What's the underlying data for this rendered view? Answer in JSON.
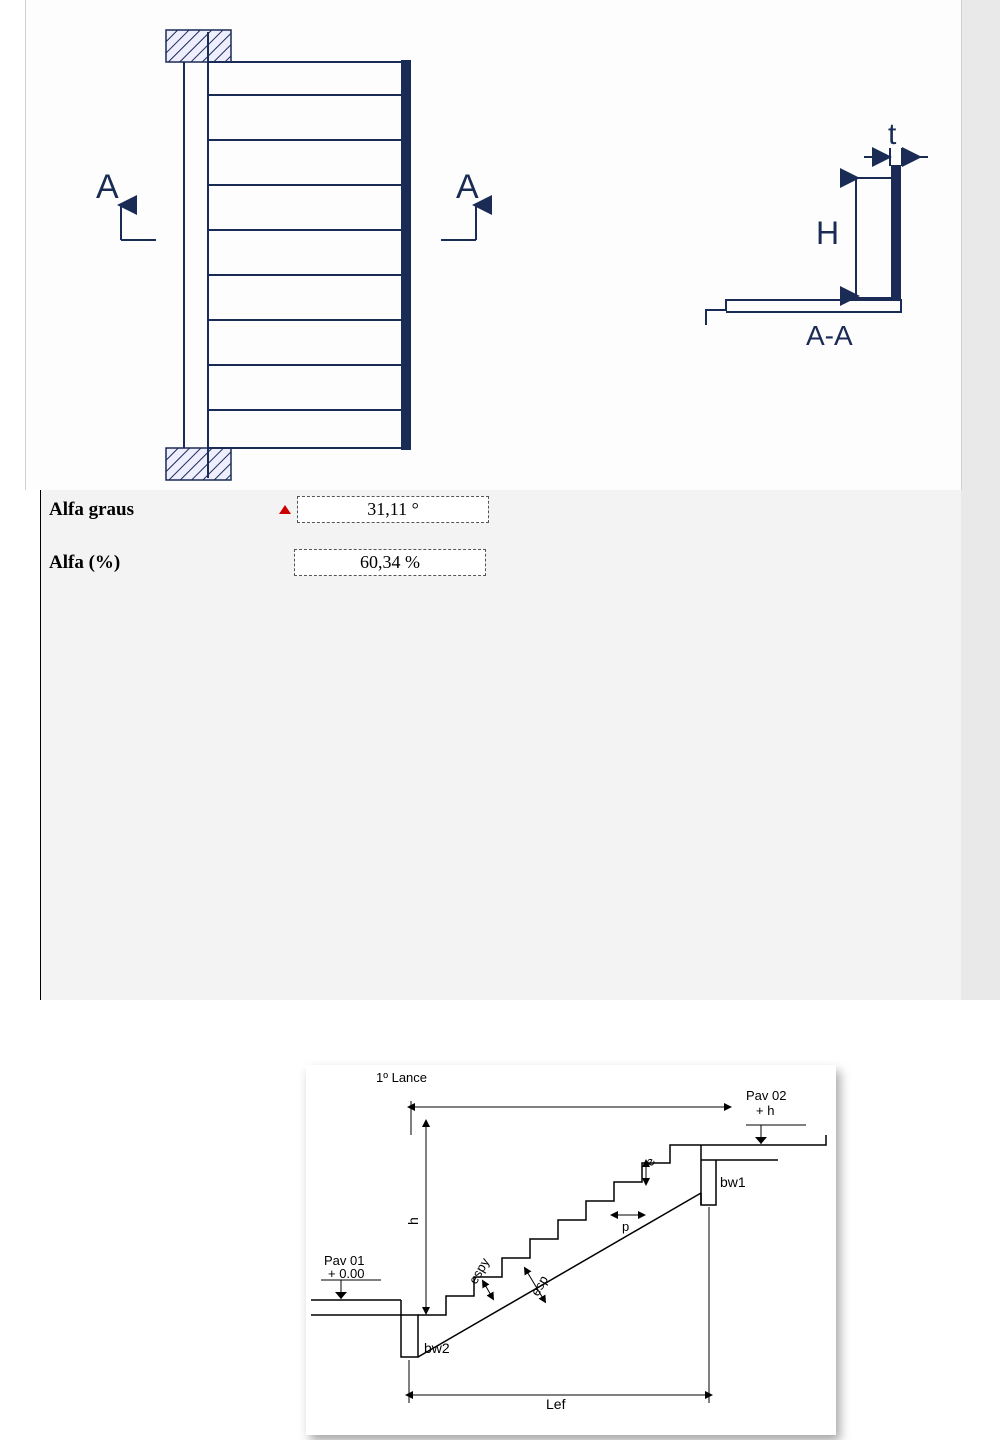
{
  "top": {
    "section_left": "A",
    "section_right": "A",
    "section_cut": "A-A",
    "dim_t": "t",
    "dim_H": "H"
  },
  "fields": {
    "alfa_graus_label": "Alfa graus",
    "alfa_graus_value": "31,11 °",
    "alfa_pct_label": "Alfa (%)",
    "alfa_pct_value": "60,34 %"
  },
  "stairDiagram": {
    "title": "1º Lance",
    "pav01_label": "Pav 01",
    "pav01_level": "+ 0.00",
    "pav02_label": "Pav 02",
    "pav02_level": "+ h",
    "bw1": "bw1",
    "bw2": "bw2",
    "lef": "Lef",
    "h": "h",
    "p": "p",
    "e": "e",
    "esp": "esp",
    "espy": "espy"
  }
}
